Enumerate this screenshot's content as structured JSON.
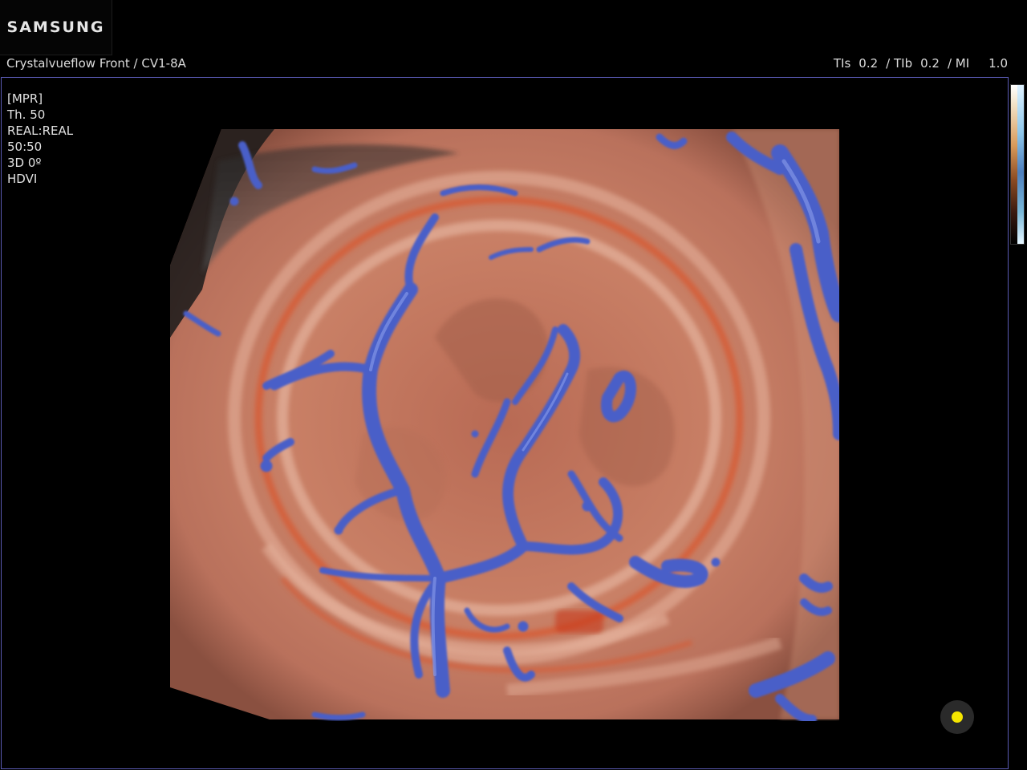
{
  "brand": {
    "logo_text": "SAMSUNG"
  },
  "header": {
    "mode_probe": "Crystalvueflow Front / CV1-8A",
    "tis_label": "TIs",
    "tis_value": "0.2",
    "tib_label": "/ TIb",
    "tib_value": "0.2",
    "mi_label": "/ MI",
    "mi_value": "1.0"
  },
  "viewport": {
    "params": [
      "[MPR]",
      "Th. 50",
      "REAL:REAL",
      "50:50",
      "3D 0º",
      "HDVI"
    ]
  },
  "colors": {
    "frame_border": "#5a5ab4",
    "vessel_blue": "#4a5ec8",
    "tissue": "#c97a5a",
    "marker_yellow": "#f5e600"
  },
  "icons": {
    "marker": "pointer-dot-icon"
  }
}
